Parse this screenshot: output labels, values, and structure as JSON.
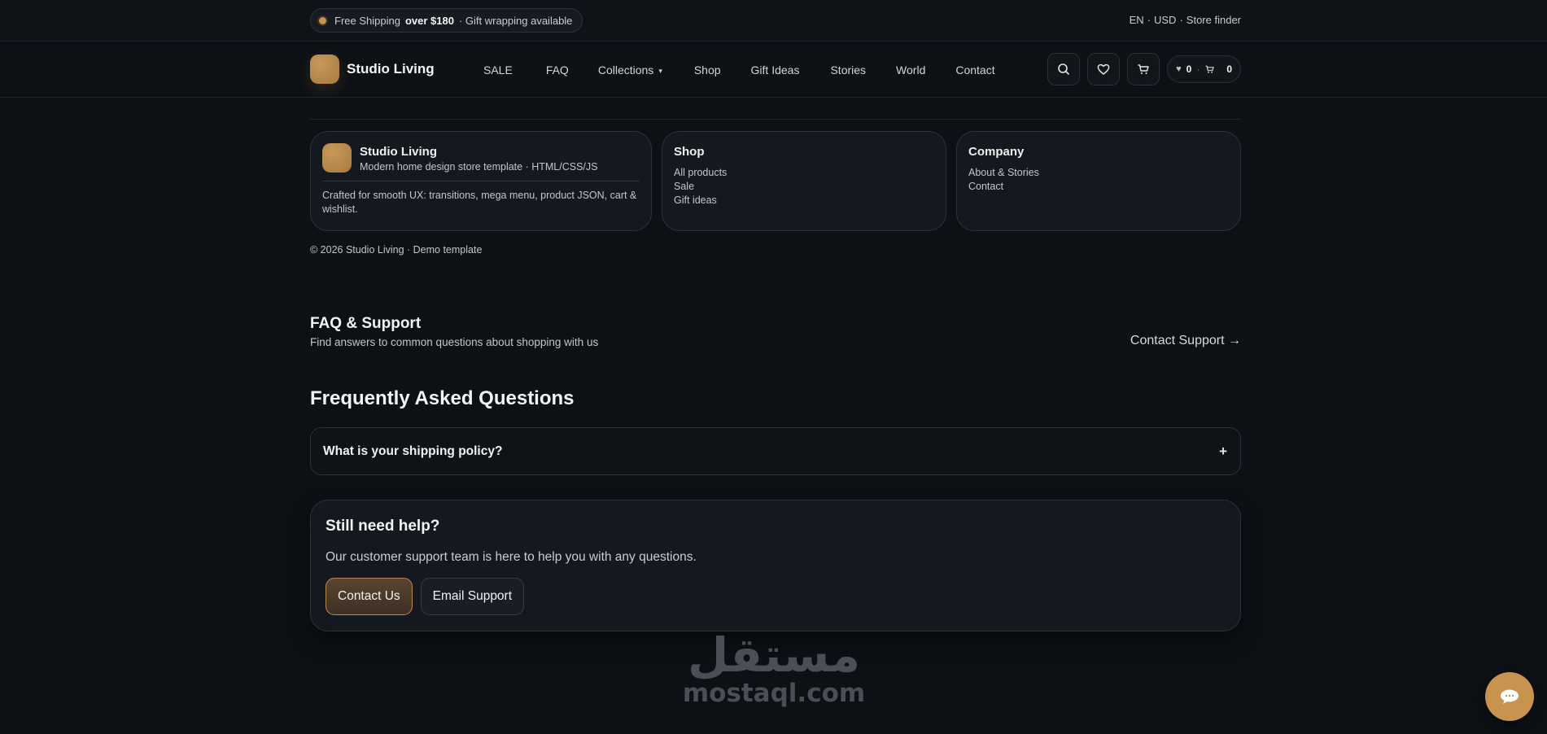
{
  "topbar": {
    "promo_prefix": "Free Shipping",
    "promo_bold": "over $180",
    "promo_suffix": "· Gift wrapping available",
    "lang": "EN",
    "currency": "USD",
    "store_finder": "Store finder",
    "dot_sep": "·"
  },
  "header": {
    "brand": "Studio Living",
    "nav": [
      "SALE",
      "FAQ",
      "Collections",
      "Shop",
      "Gift Ideas",
      "Stories",
      "World",
      "Contact"
    ],
    "collections_chevron": "▾",
    "wishlist_count": "0",
    "cart_count": "0",
    "counter_sep": "·"
  },
  "footer": {
    "brand_name": "Studio Living",
    "brand_sub": "Modern home design store template · HTML/CSS/JS",
    "brand_desc": "Crafted for smooth UX: transitions, mega menu, product JSON, cart & wishlist.",
    "shop_title": "Shop",
    "shop_links": [
      "All products",
      "Sale",
      "Gift ideas"
    ],
    "company_title": "Company",
    "company_links": [
      "About & Stories",
      "Contact"
    ],
    "copyright": "© 2026 Studio Living · Demo template"
  },
  "faq": {
    "title": "FAQ & Support",
    "subtitle": "Find answers to common questions about shopping with us",
    "contact_link": "Contact Support →",
    "heading": "Frequently Asked Questions",
    "question": "What is your shipping policy?",
    "toggle": "+"
  },
  "help": {
    "title": "Still need help?",
    "text": "Our customer support team is here to help you with any questions.",
    "primary_btn": "Contact Us",
    "secondary_btn": "Email Support"
  },
  "watermark": {
    "arabic": "مستقل",
    "latin": "mostaql.com"
  },
  "colors": {
    "accent": "#c8934f",
    "background": "#0d1015",
    "card": "#15191f"
  }
}
